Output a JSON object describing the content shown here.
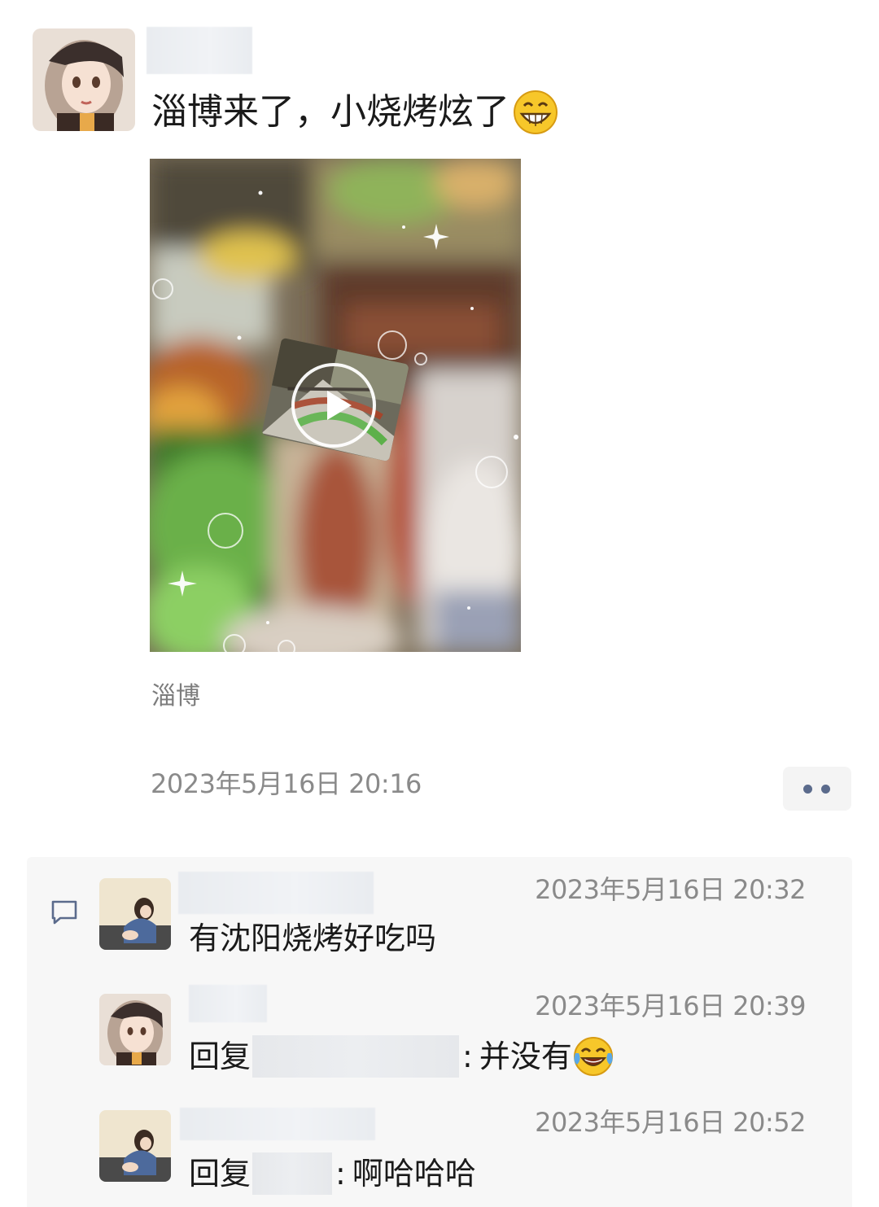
{
  "post": {
    "text": "淄博来了，小烧烤炫了",
    "emoji": "grinning-face-emoji",
    "media_type": "video",
    "location": "淄博",
    "time": "2023年5月16日 20:16",
    "more_icon": "more-dots-icon"
  },
  "comments": [
    {
      "time": "2023年5月16日 20:32",
      "text": "有沈阳烧烤好吃吗"
    },
    {
      "time": "2023年5月16日 20:39",
      "reply_prefix": "回复",
      "separator": ":",
      "text": "并没有",
      "emoji": "tears-of-joy-emoji"
    },
    {
      "time": "2023年5月16日 20:52",
      "reply_prefix": "回复",
      "separator": ":",
      "text": "啊哈哈哈"
    }
  ],
  "colors": {
    "link_icon": "#5b6b8c",
    "time_gray": "#8a8a8a",
    "panel_bg": "#f7f7f7"
  }
}
